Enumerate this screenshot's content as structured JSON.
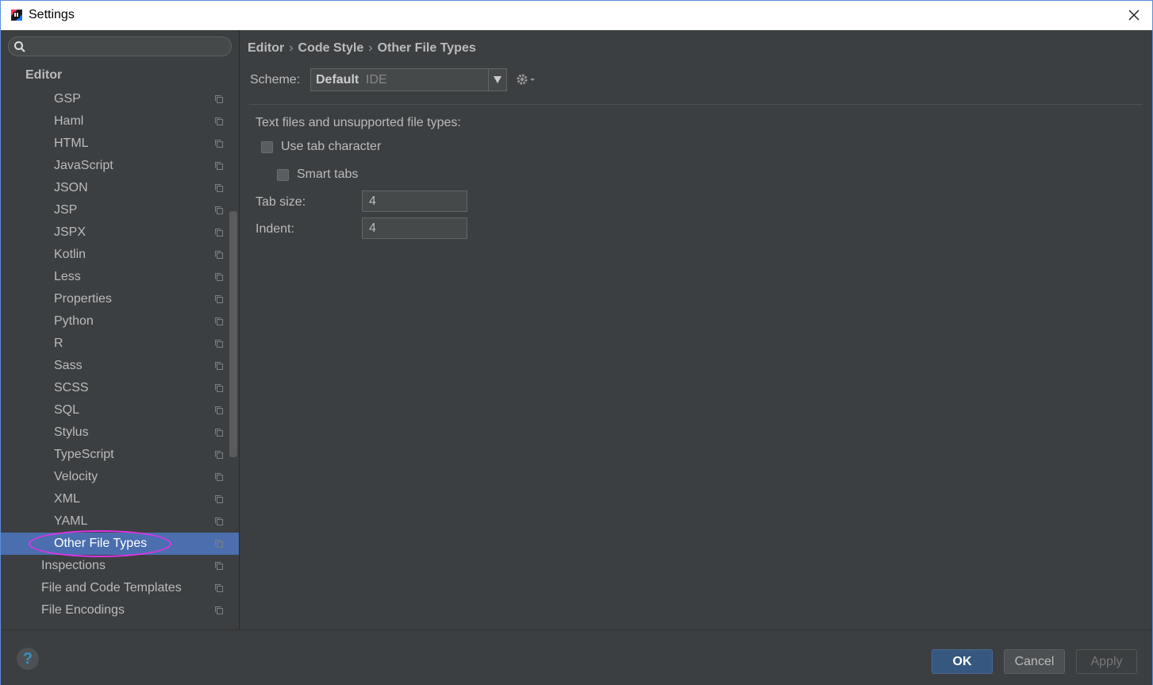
{
  "window": {
    "title": "Settings"
  },
  "sidebar": {
    "search_placeholder": "",
    "root": "Editor",
    "items": [
      {
        "label": "GSP"
      },
      {
        "label": "Haml"
      },
      {
        "label": "HTML"
      },
      {
        "label": "JavaScript"
      },
      {
        "label": "JSON"
      },
      {
        "label": "JSP"
      },
      {
        "label": "JSPX"
      },
      {
        "label": "Kotlin"
      },
      {
        "label": "Less"
      },
      {
        "label": "Properties"
      },
      {
        "label": "Python"
      },
      {
        "label": "R"
      },
      {
        "label": "Sass"
      },
      {
        "label": "SCSS"
      },
      {
        "label": "SQL"
      },
      {
        "label": "Stylus"
      },
      {
        "label": "TypeScript"
      },
      {
        "label": "Velocity"
      },
      {
        "label": "XML"
      },
      {
        "label": "YAML"
      },
      {
        "label": "Other File Types"
      }
    ],
    "selected_item": "Other File Types",
    "secondary_items": [
      {
        "label": "Inspections"
      },
      {
        "label": "File and Code Templates"
      },
      {
        "label": "File Encodings"
      }
    ]
  },
  "breadcrumb": {
    "parts": [
      "Editor",
      "Code Style",
      "Other File Types"
    ],
    "separator": "›"
  },
  "scheme": {
    "label": "Scheme:",
    "value": "Default",
    "sub": "IDE"
  },
  "section": {
    "title": "Text files and unsupported file types:",
    "use_tab_character": {
      "label": "Use tab character",
      "checked": false
    },
    "smart_tabs": {
      "label": "Smart tabs",
      "checked": false
    },
    "tab_size": {
      "label": "Tab size:",
      "value": "4"
    },
    "indent": {
      "label": "Indent:",
      "value": "4"
    }
  },
  "footer": {
    "help": "?",
    "ok": "OK",
    "cancel": "Cancel",
    "apply": "Apply"
  },
  "colors": {
    "selection": "#4b6eaf",
    "highlight_annotation": "#e033e6",
    "ok_button": "#365880"
  }
}
